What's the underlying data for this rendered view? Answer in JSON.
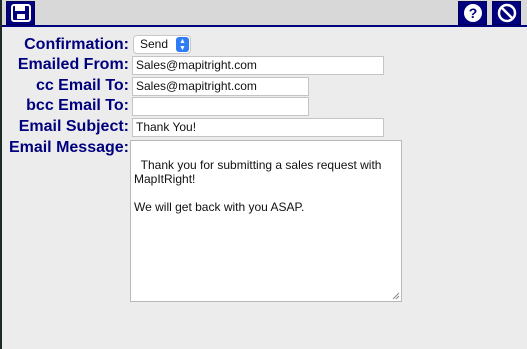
{
  "toolbar": {
    "save_icon": "floppy-disk-icon",
    "help_icon": "question-mark-icon",
    "cancel_icon": "prohibited-icon",
    "color": "#00007e"
  },
  "form": {
    "confirmation": {
      "label": "Confirmation:",
      "value": "Send"
    },
    "emailed_from": {
      "label": "Emailed From:",
      "value": "Sales@mapitright.com"
    },
    "cc_email": {
      "label": "cc Email To:",
      "value": "Sales@mapitright.com"
    },
    "bcc_email": {
      "label": "bcc Email To:",
      "value": ""
    },
    "subject": {
      "label": "Email Subject:",
      "value": "Thank You!"
    },
    "message": {
      "label": "Email Message:",
      "value": "Thank you for submitting a sales request with MapItRight!\n\nWe will get back with you ASAP."
    }
  }
}
